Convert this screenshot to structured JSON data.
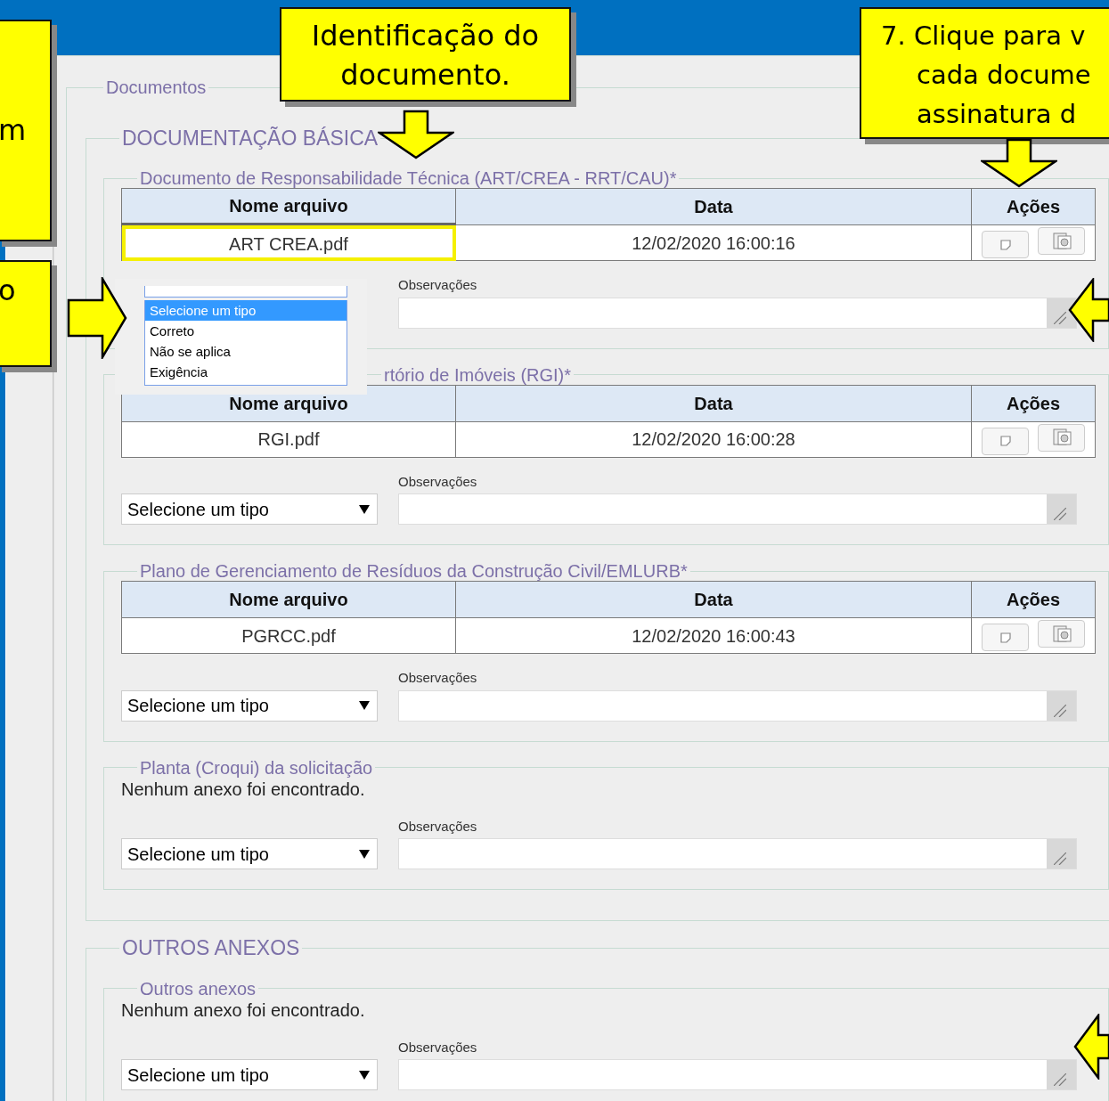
{
  "panel": {
    "legend": "Documentos"
  },
  "groups": [
    {
      "legend": "DOCUMENTAÇÃO BÁSICA",
      "sections": [
        {
          "legend": "Documento de Responsabilidade Técnica (ART/CREA - RRT/CAU)*",
          "table": {
            "columns": [
              "Nome arquivo",
              "Data",
              "Ações"
            ],
            "rows": [
              {
                "file": "ART CREA.pdf",
                "date": "12/02/2020 16:00:16",
                "highlighted": true
              }
            ]
          },
          "observations_label": "Observações",
          "dropdown": {
            "options": [
              {
                "label": "Selecione um tipo",
                "selected": true
              },
              {
                "label": "Correto",
                "selected": false
              },
              {
                "label": "Não se aplica",
                "selected": false
              },
              {
                "label": "Exigência",
                "selected": false
              }
            ]
          }
        },
        {
          "legend": "rtório de Imóveis (RGI)*",
          "legend_cut": true,
          "table": {
            "columns": [
              "Nome arquivo",
              "Data",
              "Ações"
            ],
            "rows": [
              {
                "file": "RGI.pdf",
                "date": "12/02/2020 16:00:28",
                "highlighted": false
              }
            ]
          },
          "observations_label": "Observações",
          "select": "Selecione um tipo"
        },
        {
          "legend": "Plano de Gerenciamento de Resíduos da Construção Civil/EMLURB*",
          "table": {
            "columns": [
              "Nome arquivo",
              "Data",
              "Ações"
            ],
            "rows": [
              {
                "file": "PGRCC.pdf",
                "date": "12/02/2020 16:00:43",
                "highlighted": false
              }
            ]
          },
          "observations_label": "Observações",
          "select": "Selecione um tipo"
        },
        {
          "legend": "Planta (Croqui) da solicitação",
          "empty_text": "Nenhum anexo foi encontrado.",
          "observations_label": "Observações",
          "select": "Selecione um tipo"
        }
      ]
    },
    {
      "legend": "OUTROS ANEXOS",
      "sections": [
        {
          "legend": "Outros anexos",
          "empty_text": "Nenhum anexo foi encontrado.",
          "observations_label": "Observações",
          "select": "Selecione um tipo"
        }
      ]
    }
  ],
  "callouts": [
    {
      "kind": "left-top",
      "lines": [
        "m"
      ]
    },
    {
      "kind": "left-bottom",
      "lines": [
        "o"
      ]
    },
    {
      "kind": "top-center",
      "lines": [
        "Identificação do",
        "documento."
      ]
    },
    {
      "kind": "top-right",
      "lines": [
        "7. Clique para v",
        "cada docume",
        "assinatura d"
      ]
    }
  ]
}
